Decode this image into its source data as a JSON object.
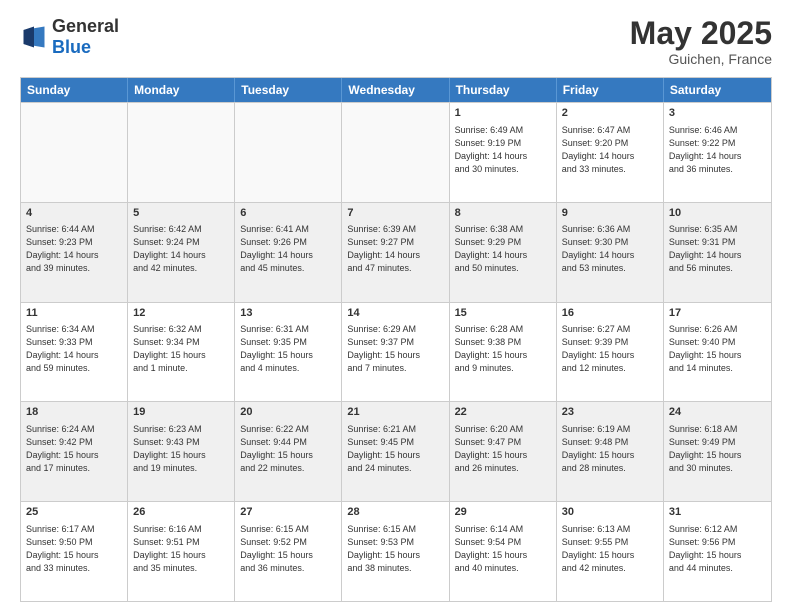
{
  "logo": {
    "general": "General",
    "blue": "Blue"
  },
  "header": {
    "month": "May 2025",
    "location": "Guichen, France"
  },
  "weekdays": [
    "Sunday",
    "Monday",
    "Tuesday",
    "Wednesday",
    "Thursday",
    "Friday",
    "Saturday"
  ],
  "rows": [
    [
      {
        "day": "",
        "info": "",
        "empty": true
      },
      {
        "day": "",
        "info": "",
        "empty": true
      },
      {
        "day": "",
        "info": "",
        "empty": true
      },
      {
        "day": "",
        "info": "",
        "empty": true
      },
      {
        "day": "1",
        "info": "Sunrise: 6:49 AM\nSunset: 9:19 PM\nDaylight: 14 hours\nand 30 minutes.",
        "empty": false
      },
      {
        "day": "2",
        "info": "Sunrise: 6:47 AM\nSunset: 9:20 PM\nDaylight: 14 hours\nand 33 minutes.",
        "empty": false
      },
      {
        "day": "3",
        "info": "Sunrise: 6:46 AM\nSunset: 9:22 PM\nDaylight: 14 hours\nand 36 minutes.",
        "empty": false
      }
    ],
    [
      {
        "day": "4",
        "info": "Sunrise: 6:44 AM\nSunset: 9:23 PM\nDaylight: 14 hours\nand 39 minutes.",
        "empty": false
      },
      {
        "day": "5",
        "info": "Sunrise: 6:42 AM\nSunset: 9:24 PM\nDaylight: 14 hours\nand 42 minutes.",
        "empty": false
      },
      {
        "day": "6",
        "info": "Sunrise: 6:41 AM\nSunset: 9:26 PM\nDaylight: 14 hours\nand 45 minutes.",
        "empty": false
      },
      {
        "day": "7",
        "info": "Sunrise: 6:39 AM\nSunset: 9:27 PM\nDaylight: 14 hours\nand 47 minutes.",
        "empty": false
      },
      {
        "day": "8",
        "info": "Sunrise: 6:38 AM\nSunset: 9:29 PM\nDaylight: 14 hours\nand 50 minutes.",
        "empty": false
      },
      {
        "day": "9",
        "info": "Sunrise: 6:36 AM\nSunset: 9:30 PM\nDaylight: 14 hours\nand 53 minutes.",
        "empty": false
      },
      {
        "day": "10",
        "info": "Sunrise: 6:35 AM\nSunset: 9:31 PM\nDaylight: 14 hours\nand 56 minutes.",
        "empty": false
      }
    ],
    [
      {
        "day": "11",
        "info": "Sunrise: 6:34 AM\nSunset: 9:33 PM\nDaylight: 14 hours\nand 59 minutes.",
        "empty": false
      },
      {
        "day": "12",
        "info": "Sunrise: 6:32 AM\nSunset: 9:34 PM\nDaylight: 15 hours\nand 1 minute.",
        "empty": false
      },
      {
        "day": "13",
        "info": "Sunrise: 6:31 AM\nSunset: 9:35 PM\nDaylight: 15 hours\nand 4 minutes.",
        "empty": false
      },
      {
        "day": "14",
        "info": "Sunrise: 6:29 AM\nSunset: 9:37 PM\nDaylight: 15 hours\nand 7 minutes.",
        "empty": false
      },
      {
        "day": "15",
        "info": "Sunrise: 6:28 AM\nSunset: 9:38 PM\nDaylight: 15 hours\nand 9 minutes.",
        "empty": false
      },
      {
        "day": "16",
        "info": "Sunrise: 6:27 AM\nSunset: 9:39 PM\nDaylight: 15 hours\nand 12 minutes.",
        "empty": false
      },
      {
        "day": "17",
        "info": "Sunrise: 6:26 AM\nSunset: 9:40 PM\nDaylight: 15 hours\nand 14 minutes.",
        "empty": false
      }
    ],
    [
      {
        "day": "18",
        "info": "Sunrise: 6:24 AM\nSunset: 9:42 PM\nDaylight: 15 hours\nand 17 minutes.",
        "empty": false
      },
      {
        "day": "19",
        "info": "Sunrise: 6:23 AM\nSunset: 9:43 PM\nDaylight: 15 hours\nand 19 minutes.",
        "empty": false
      },
      {
        "day": "20",
        "info": "Sunrise: 6:22 AM\nSunset: 9:44 PM\nDaylight: 15 hours\nand 22 minutes.",
        "empty": false
      },
      {
        "day": "21",
        "info": "Sunrise: 6:21 AM\nSunset: 9:45 PM\nDaylight: 15 hours\nand 24 minutes.",
        "empty": false
      },
      {
        "day": "22",
        "info": "Sunrise: 6:20 AM\nSunset: 9:47 PM\nDaylight: 15 hours\nand 26 minutes.",
        "empty": false
      },
      {
        "day": "23",
        "info": "Sunrise: 6:19 AM\nSunset: 9:48 PM\nDaylight: 15 hours\nand 28 minutes.",
        "empty": false
      },
      {
        "day": "24",
        "info": "Sunrise: 6:18 AM\nSunset: 9:49 PM\nDaylight: 15 hours\nand 30 minutes.",
        "empty": false
      }
    ],
    [
      {
        "day": "25",
        "info": "Sunrise: 6:17 AM\nSunset: 9:50 PM\nDaylight: 15 hours\nand 33 minutes.",
        "empty": false
      },
      {
        "day": "26",
        "info": "Sunrise: 6:16 AM\nSunset: 9:51 PM\nDaylight: 15 hours\nand 35 minutes.",
        "empty": false
      },
      {
        "day": "27",
        "info": "Sunrise: 6:15 AM\nSunset: 9:52 PM\nDaylight: 15 hours\nand 36 minutes.",
        "empty": false
      },
      {
        "day": "28",
        "info": "Sunrise: 6:15 AM\nSunset: 9:53 PM\nDaylight: 15 hours\nand 38 minutes.",
        "empty": false
      },
      {
        "day": "29",
        "info": "Sunrise: 6:14 AM\nSunset: 9:54 PM\nDaylight: 15 hours\nand 40 minutes.",
        "empty": false
      },
      {
        "day": "30",
        "info": "Sunrise: 6:13 AM\nSunset: 9:55 PM\nDaylight: 15 hours\nand 42 minutes.",
        "empty": false
      },
      {
        "day": "31",
        "info": "Sunrise: 6:12 AM\nSunset: 9:56 PM\nDaylight: 15 hours\nand 44 minutes.",
        "empty": false
      }
    ]
  ]
}
